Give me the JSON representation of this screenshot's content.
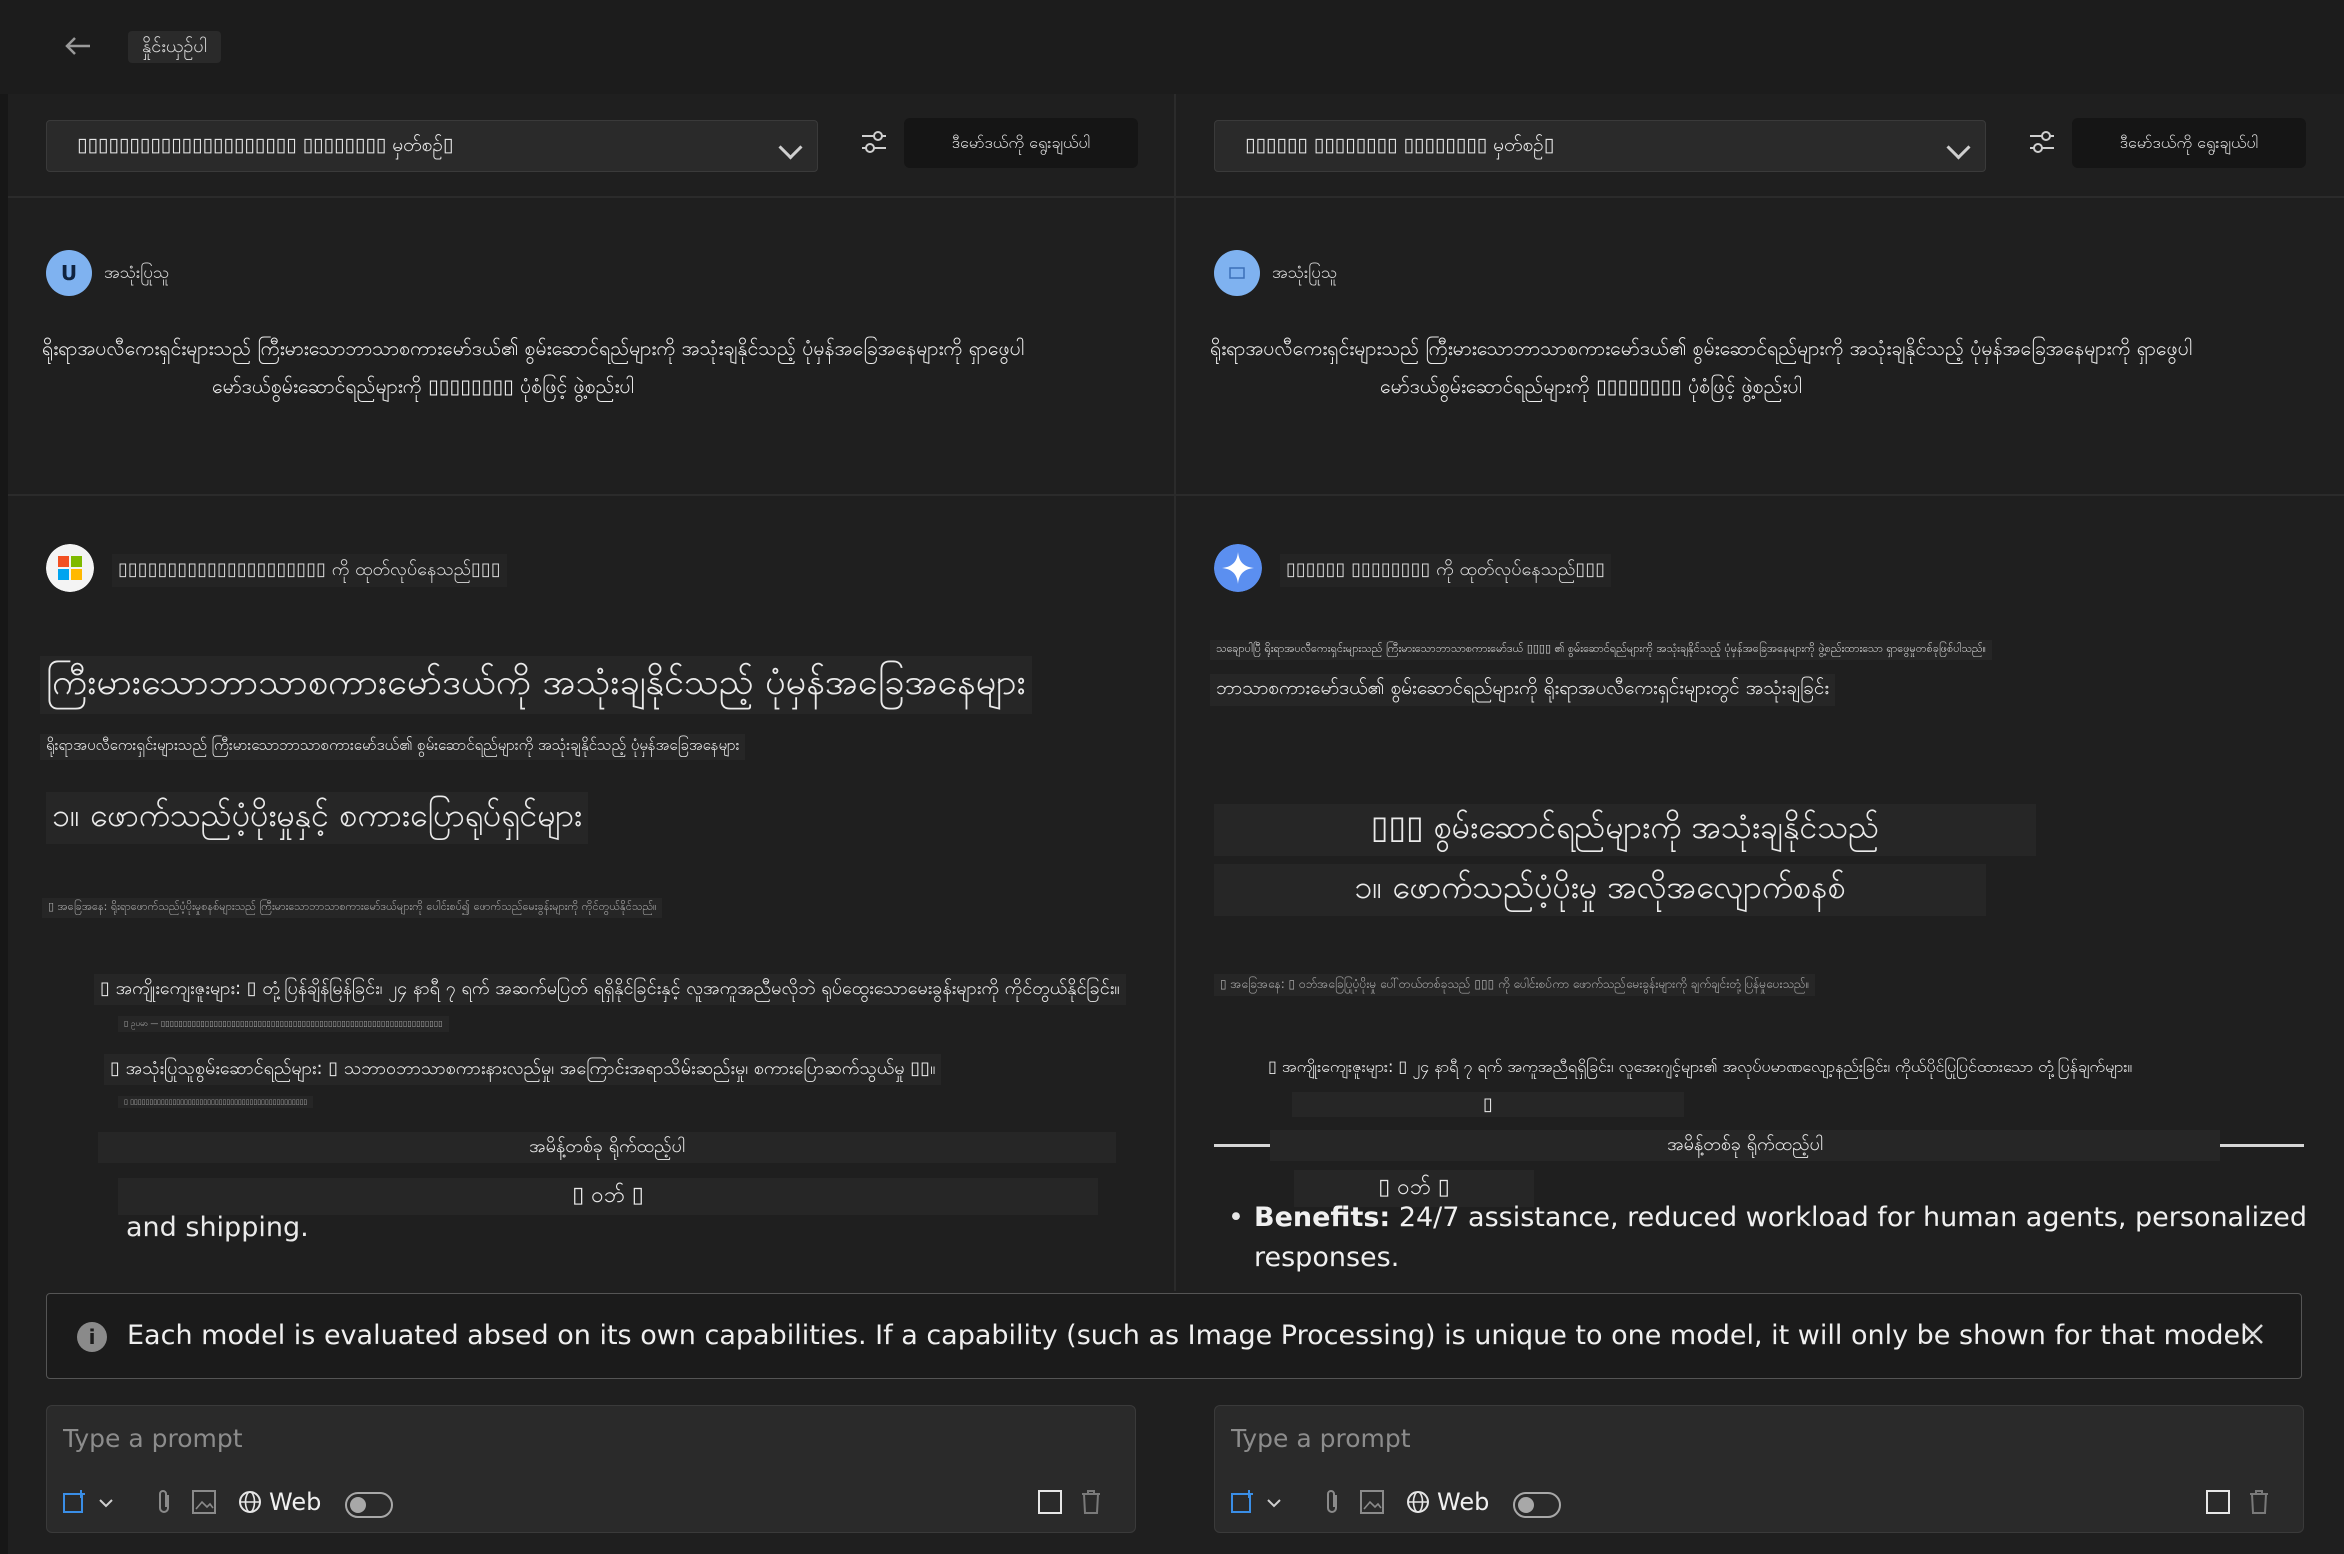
{
  "header": {
    "compare_label": "နှိုင်းယှဉ်ပါ"
  },
  "panes": [
    {
      "model_select": "▯▯▯▯▯▯▯▯▯▯▯▯▯▯▯▯▯▯▯▯▯ ▯▯▯▯▯▯▯▯ မှတ်စဉ်▯",
      "system_msg_button": "ဒီမော်ဒယ်ကို ရွေးချယ်ပါ",
      "user_name": "အသုံးပြုသူ",
      "avatar_letter": "U",
      "user_message_line1": "ရိုးရာအပလီကေးရှင်းများသည် ကြီးမားသောဘာသာစကားမော်ဒယ်၏ စွမ်းဆောင်ရည်များကို အသုံးချနိုင်သည့် ပုံမှန်အခြေအနေများကို ရှာဖွေပါ",
      "user_message_line2": "မော်ဒယ်စွမ်းဆောင်ရည်များကို ▯▯▯▯▯▯▯▯ ပုံစံဖြင့် ဖွဲ့စည်းပါ",
      "bot_status": "▯▯▯▯▯▯▯▯▯▯▯▯▯▯▯▯▯▯▯▯▯ ကို ထုတ်လုပ်နေသည်▯▯▯",
      "lines": [
        "ကြီးမားသောဘာသာစကားမော်ဒယ်ကို အသုံးချနိုင်သည့် ပုံမှန်အခြေအနေများ",
        "ရိုးရာအပလီကေးရှင်းများသည် ကြီးမားသောဘာသာစကားမော်ဒယ်၏ စွမ်းဆောင်ရည်များကို အသုံးချနိုင်သည့် ပုံမှန်အခြေအနေများ",
        "၁။ ဖောက်သည်ပံ့ပိုးမှုနှင့် စကားပြောရုပ်ရှင်များ",
        "▯ အခြေအနေ: ရိုးရာဖောက်သည်ပံ့ပိုးမှုစနစ်များသည် ကြီးမားသောဘာသာစကားမော်ဒယ်များကို ပေါင်းစပ်၍ ဖောက်သည်မေးခွန်းများကို ကိုင်တွယ်နိုင်သည်။",
        "▯ အကျိုးကျေးဇူးများ: ▯ တုံ့ပြန်ချိန်မြန်ခြင်း၊ ၂၄ နာရီ ၇ ရက် အဆက်မပြတ် ရရှိနိုင်ခြင်းနှင့် လူအကူအညီမလိုဘဲ ရုပ်ထွေးသောမေးခွန်းများကို ကိုင်တွယ်နိုင်ခြင်း။",
        "▯ ဥပမာ — ▯▯▯▯▯▯▯▯▯▯▯▯▯▯▯▯▯▯▯▯▯▯▯▯▯▯▯▯▯▯▯▯▯▯▯▯▯▯▯▯▯▯▯▯▯▯▯▯▯▯▯▯▯▯▯▯▯▯▯▯▯▯▯▯",
        "▯ အသုံးပြုသူစွမ်းဆောင်ရည်များ: ▯ သဘာဝဘာသာစကားနားလည်မှု၊ အကြောင်းအရာသိမ်းဆည်းမှု၊ စကားပြောဆက်သွယ်မှု ▯▯။",
        "▯ ▯▯▯▯▯▯▯▯▯▯▯▯▯▯▯▯▯▯▯▯▯▯▯▯▯▯▯▯▯▯▯▯▯▯▯▯▯▯▯▯▯▯▯▯▯▯",
        "အမိန့်တစ်ခု ရိုက်ထည့်ပါ",
        "▯ ဝဘ် ▯",
        "and shipping."
      ],
      "composer": {
        "placeholder": "Type a prompt",
        "web_label": "Web"
      }
    },
    {
      "model_select": "▯▯▯▯▯▯ ▯▯▯▯▯▯▯▯ ▯▯▯▯▯▯▯▯ မှတ်စဉ်▯",
      "system_msg_button": "ဒီမော်ဒယ်ကို ရွေးချယ်ပါ",
      "user_name": "အသုံးပြုသူ",
      "avatar_letter": "",
      "user_message_line1": "ရိုးရာအပလီကေးရှင်းများသည် ကြီးမားသောဘာသာစကားမော်ဒယ်၏ စွမ်းဆောင်ရည်များကို အသုံးချနိုင်သည့် ပုံမှန်အခြေအနေများကို ရှာဖွေပါ",
      "user_message_line2": "မော်ဒယ်စွမ်းဆောင်ရည်များကို ▯▯▯▯▯▯▯▯ ပုံစံဖြင့် ဖွဲ့စည်းပါ",
      "bot_status": "▯▯▯▯▯▯ ▯▯▯▯▯▯▯▯ ကို ထုတ်လုပ်နေသည်▯▯▯",
      "lines": [
        "သချောပါပြီ ရိုးရာအပလီကေးရှင်းများသည် ကြီးမားသောဘာသာစကားမော်ဒယ် ▯▯▯▯ ၏ စွမ်းဆောင်ရည်များကို အသုံးချနိုင်သည့် ပုံမှန်အခြေအနေများကို ဖွဲ့စည်းထားသော ရှာဖွေမှုတစ်ခုဖြစ်ပါသည်။",
        "ဘာသာစကားမော်ဒယ်၏ စွမ်းဆောင်ရည်များကို ရိုးရာအပလီကေးရှင်းများတွင် အသုံးချခြင်း",
        "▯▯▯ စွမ်းဆောင်ရည်များကို အသုံးချနိုင်သည်",
        "၁။ ဖောက်သည်ပံ့ပိုးမှု အလိုအလျောက်စနစ်",
        "▯ အခြေအနေ: ▯ ဝဘ်အခြေပြုပံ့ပိုးမှု ပေါ်တယ်တစ်ခုသည် ▯▯▯ ကို ပေါင်းစပ်ကာ ဖောက်သည်မေးခွန်းများကို ချက်ချင်းတုံ့ပြန်မှုပေးသည်။",
        "▯ အကျိုးကျေးဇူးများ: ▯ ၂၄ နာရီ ၇ ရက် အကူအညီရရှိခြင်း၊ လူအေးဂျင့်များ၏ အလုပ်ပမာဏလျော့နည်းခြင်း၊ ကိုယ်ပိုင်ပြုပြင်ထားသော တုံ့ပြန်ချက်များ။",
        "▯",
        "အမိန့်တစ်ခု ရိုက်ထည့်ပါ",
        "▯ ဝဘ် ▯"
      ],
      "bullet": {
        "label": "Benefits:",
        "text_line1": "24/7 assistance, reduced workload for human agents, personalized",
        "text_line2": "responses."
      },
      "composer": {
        "placeholder": "Type a prompt",
        "web_label": "Web"
      }
    }
  ],
  "notice": {
    "text": "Each model is evaluated absed on its own capabilities. If a capability (such as Image Processing) is unique to one model, it will only be shown for that model."
  },
  "colors": {
    "avatar_user": "#7fb2f0",
    "gemini_blue": "#5b8ff0",
    "notice_border": "#555555"
  }
}
